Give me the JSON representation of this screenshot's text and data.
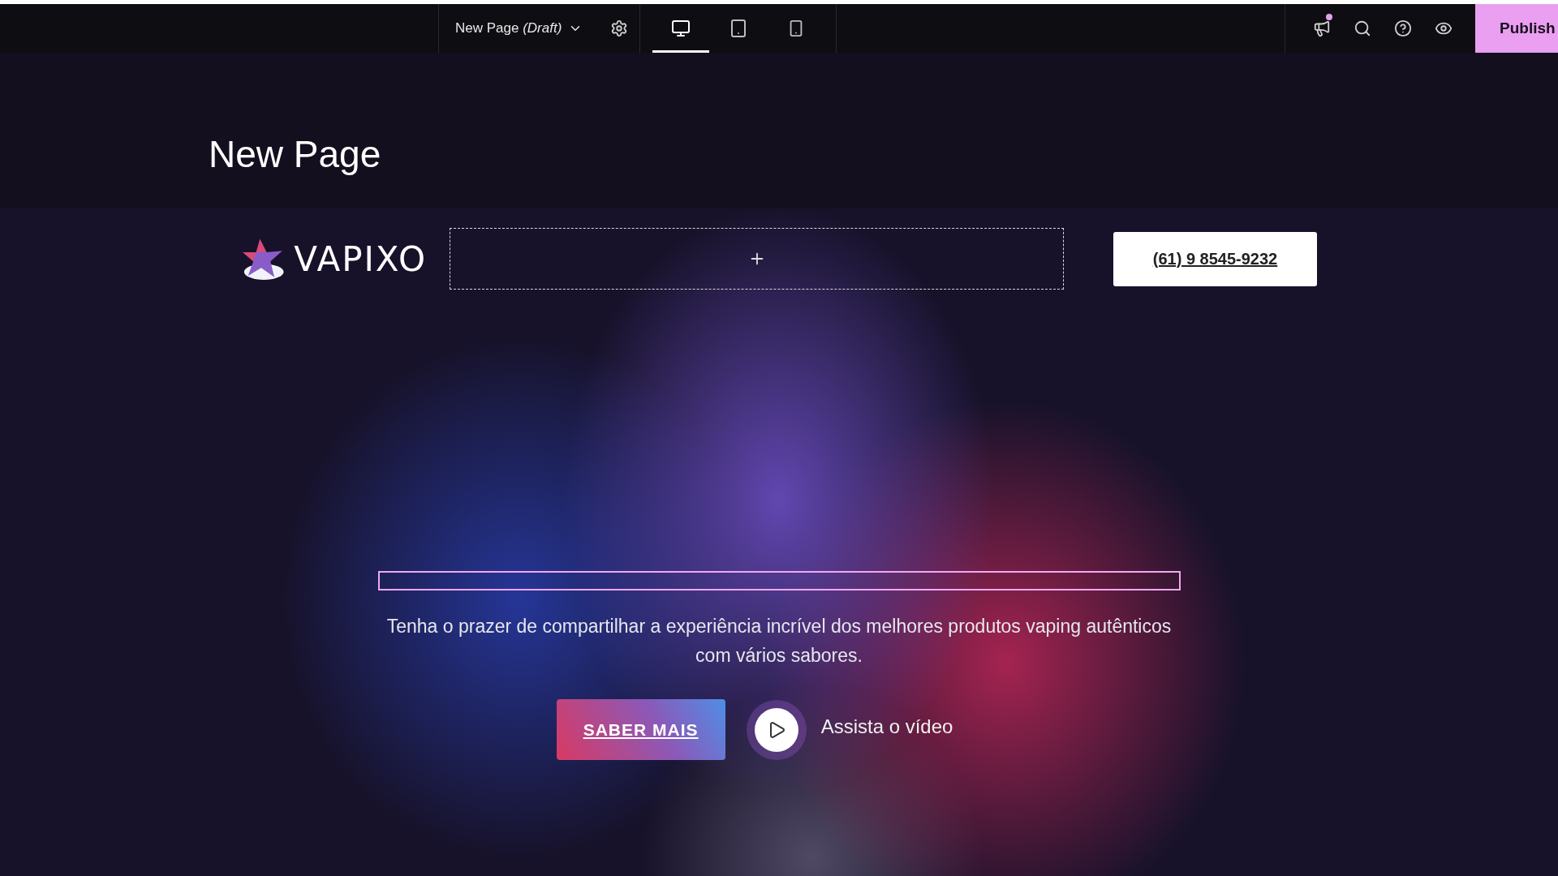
{
  "toolbar": {
    "page_title": "New Page",
    "page_status": "(Draft)",
    "devices": [
      {
        "kind": "desktop",
        "selected": true
      },
      {
        "kind": "tablet",
        "selected": false
      },
      {
        "kind": "mobile",
        "selected": false
      }
    ],
    "publish_label": "Publish"
  },
  "page": {
    "title": "New Page"
  },
  "hero": {
    "logo_text": "VAPIXO",
    "phone": "(61) 9 8545-9232",
    "description": "Tenha o prazer de compartilhar a experiência incrível dos melhores produtos vaping autênticos com vários sabores.",
    "cta_label": "SABER MAIS",
    "video_label": "Assista o vídeo"
  }
}
